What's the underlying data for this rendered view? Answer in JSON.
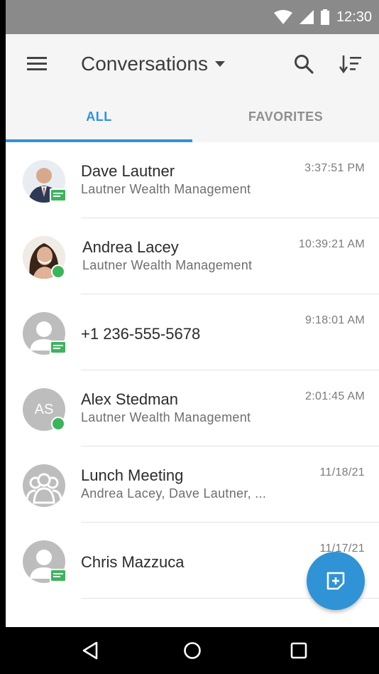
{
  "status_bar": {
    "time": "12:30"
  },
  "app_bar": {
    "title": "Conversations"
  },
  "tabs": [
    {
      "label": "ALL",
      "active": true
    },
    {
      "label": "FAVORITES",
      "active": false
    }
  ],
  "conversations": [
    {
      "name": "Dave Lautner",
      "subtitle": "Lautner Wealth Management",
      "time": "3:37:51 PM",
      "avatar": "photo",
      "badge": "sms-icon"
    },
    {
      "name": "Andrea Lacey",
      "subtitle": "Lautner Wealth Management",
      "time": "10:39:21 AM",
      "avatar": "photo",
      "badge": "online-dot"
    },
    {
      "name": "+1 236-555-5678",
      "subtitle": "",
      "time": "9:18:01 AM",
      "avatar": "person-icon",
      "badge": "sms-icon"
    },
    {
      "name": "Alex Stedman",
      "subtitle": "Lautner Wealth Management",
      "time": "2:01:45 AM",
      "avatar": "initials",
      "initials": "AS",
      "badge": "online-dot"
    },
    {
      "name": "Lunch Meeting",
      "subtitle": "Andrea Lacey, Dave Lautner, ...",
      "time": "11/18/21",
      "avatar": "group-icon",
      "badge": ""
    },
    {
      "name": "Chris Mazzuca",
      "subtitle": "",
      "time": "11/17/21",
      "avatar": "person-icon",
      "badge": "sms-icon"
    }
  ],
  "colors": {
    "accent": "#2f93d6",
    "online": "#3bb55b",
    "sms_badge": "#3bb55b",
    "status_bar": "#8a8a8a"
  }
}
